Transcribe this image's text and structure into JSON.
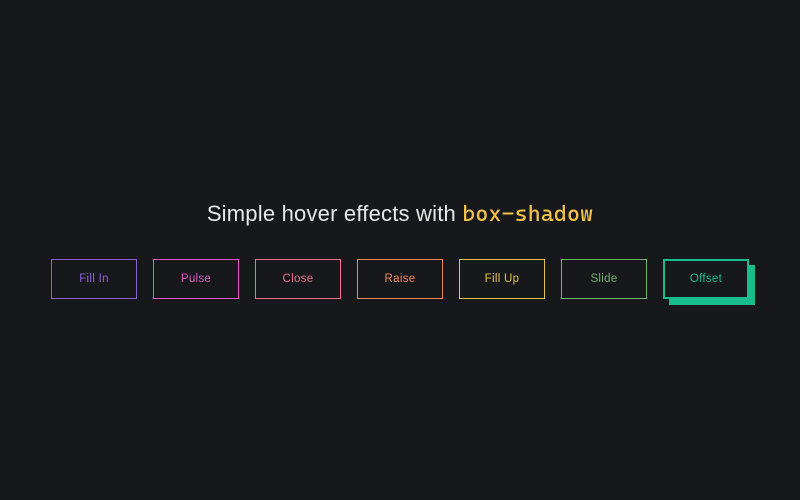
{
  "heading": {
    "prefix": "Simple hover effects with ",
    "code": "box-shadow"
  },
  "buttons": [
    {
      "label": "Fill In",
      "name": "fill-in-button",
      "class": "btn-fillin"
    },
    {
      "label": "Pulse",
      "name": "pulse-button",
      "class": "btn-pulse"
    },
    {
      "label": "Close",
      "name": "close-button",
      "class": "btn-close"
    },
    {
      "label": "Raise",
      "name": "raise-button",
      "class": "btn-raise"
    },
    {
      "label": "Fill Up",
      "name": "fill-up-button",
      "class": "btn-fillup"
    },
    {
      "label": "Slide",
      "name": "slide-button",
      "class": "btn-slide"
    },
    {
      "label": "Offset",
      "name": "offset-button",
      "class": "btn-offset"
    }
  ],
  "colors": {
    "background": "#17181c",
    "heading_text": "#e8e8e8",
    "code_text": "#f3c14a",
    "fillin": "#8a63d2",
    "pulse": "#e156c0",
    "close": "#ef6e8a",
    "raise": "#f08a5d",
    "fillup": "#e1c34a",
    "slide": "#6fb36f",
    "offset": "#19bc8b"
  }
}
